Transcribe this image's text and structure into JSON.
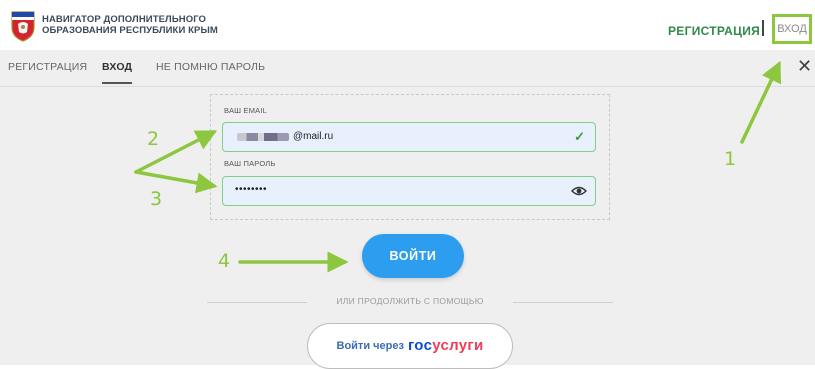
{
  "header": {
    "brand_line1": "НАВИГАТОР ДОПОЛНИТЕЛЬНОГО",
    "brand_line2": "ОБРАЗОВАНИЯ РЕСПУБЛИКИ КРЫМ",
    "register_label": "РЕГИСТРАЦИЯ",
    "login_label": "ВХОД"
  },
  "modal": {
    "tabs": [
      {
        "label": "РЕГИСТРАЦИЯ",
        "active": false
      },
      {
        "label": "ВХОД",
        "active": true
      },
      {
        "label": "НЕ ПОМНЮ ПАРОЛЬ",
        "active": false
      }
    ],
    "close_icon": "close-icon",
    "form": {
      "email_label": "ВАШ EMAIL",
      "email_value": "@mail.ru",
      "password_label": "ВАШ ПАРОЛЬ",
      "password_value": "••••••••"
    },
    "login_button": "ВОЙТИ",
    "divider_text": "ИЛИ ПРОДОЛЖИТЬ С ПОМОЩЬЮ",
    "gosuslugi": {
      "prefix": "Войти через",
      "logo_part1": "гос",
      "logo_part2": "услуги"
    }
  },
  "annotations": {
    "markers": [
      "1",
      "2",
      "3",
      "4"
    ],
    "color": "#8dc63f"
  },
  "colors": {
    "accent_green": "#2f8a4a",
    "button_blue": "#2d9df0",
    "valid_border": "#7fd17f",
    "field_bg": "#e8f0fe"
  }
}
